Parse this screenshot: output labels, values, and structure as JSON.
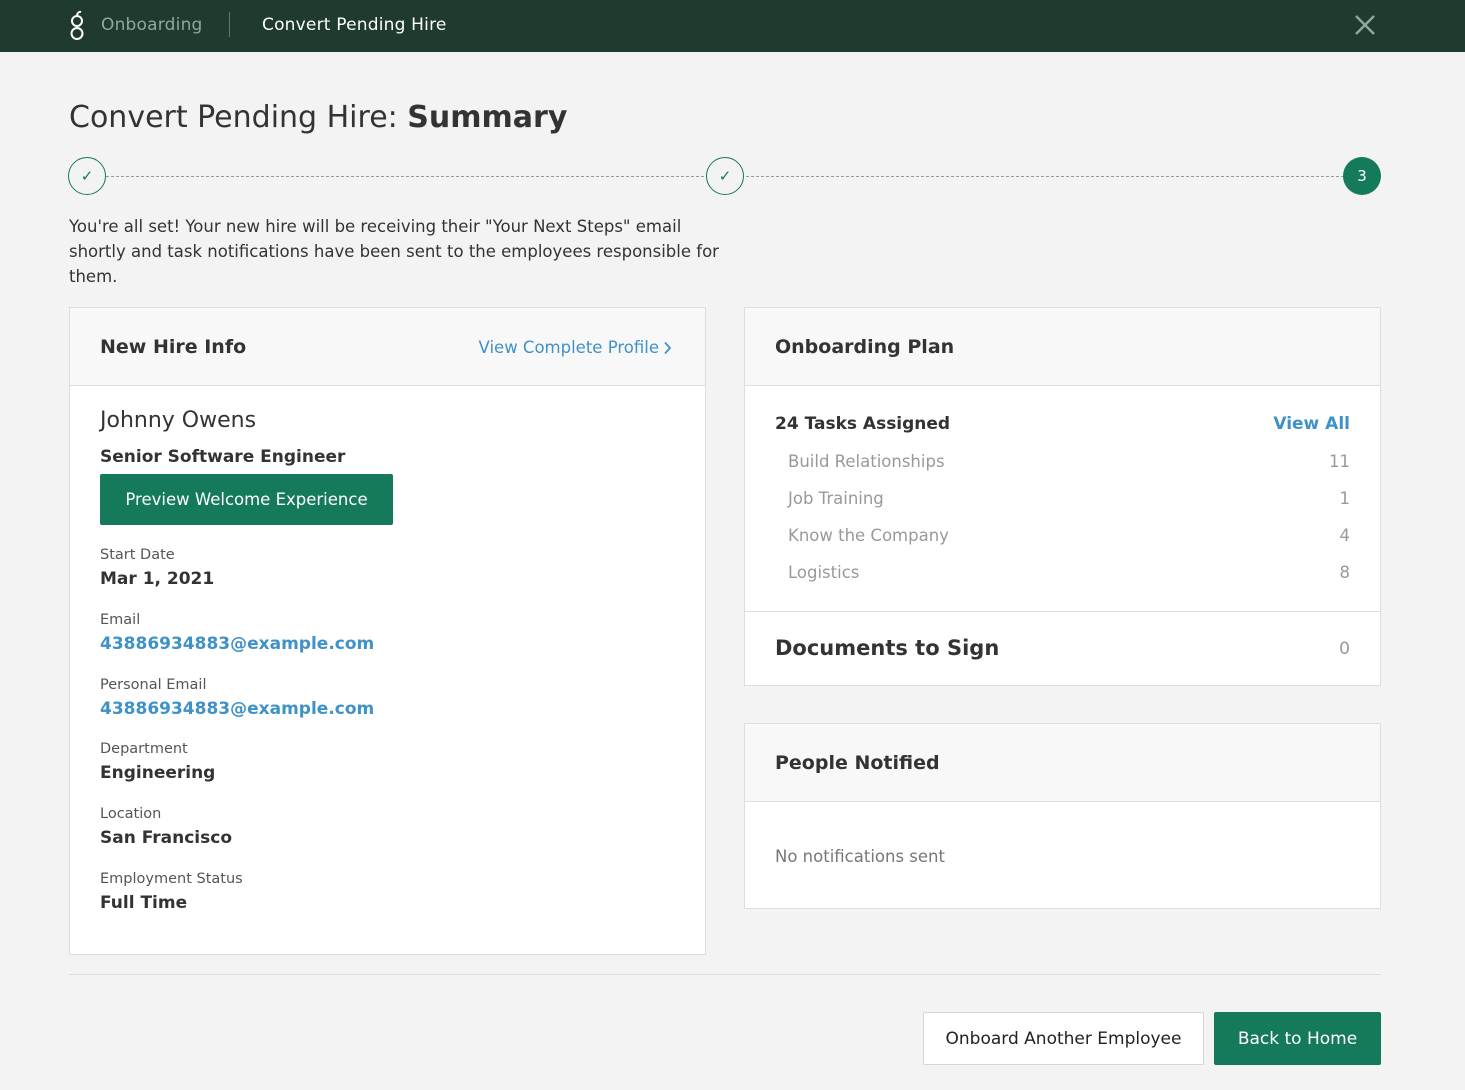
{
  "header": {
    "breadcrumb_root": "Onboarding",
    "breadcrumb_current": "Convert Pending Hire",
    "logo_icon": "greenhouse-g-logo",
    "close_icon": "close-icon"
  },
  "page": {
    "title_prefix": "Convert Pending Hire: ",
    "title_bold": "Summary",
    "intro": "You're all set! Your new hire will be receiving their \"Your Next Steps\" email shortly and task notifications have been sent to the employees responsible for them."
  },
  "stepper": {
    "steps": [
      {
        "label": "✓",
        "state": "done"
      },
      {
        "label": "✓",
        "state": "done"
      },
      {
        "label": "3",
        "state": "active"
      }
    ]
  },
  "new_hire": {
    "card_title": "New Hire Info",
    "view_profile_label": "View Complete Profile",
    "name": "Johnny Owens",
    "job_title": "Senior Software Engineer",
    "preview_button": "Preview Welcome Experience",
    "fields": [
      {
        "label": "Start Date",
        "value": "Mar 1, 2021"
      },
      {
        "label": "Email",
        "value": "43886934883@example.com"
      },
      {
        "label": "Personal Email",
        "value": "43886934883@example.com"
      },
      {
        "label": "Department",
        "value": "Engineering"
      },
      {
        "label": "Location",
        "value": "San Francisco"
      },
      {
        "label": "Employment Status",
        "value": "Full Time"
      }
    ]
  },
  "onboarding_plan": {
    "card_title": "Onboarding Plan",
    "tasks_heading": "24 Tasks Assigned",
    "view_all_label": "View All",
    "tasks": [
      {
        "name": "Build Relationships",
        "count": "11"
      },
      {
        "name": "Job Training",
        "count": "1"
      },
      {
        "name": "Know the Company",
        "count": "4"
      },
      {
        "name": "Logistics",
        "count": "8"
      }
    ],
    "documents_label": "Documents to Sign",
    "documents_count": "0"
  },
  "people_notified": {
    "card_title": "People Notified",
    "empty_text": "No notifications sent"
  },
  "footer": {
    "secondary_button": "Onboard Another Employee",
    "primary_button": "Back to Home"
  },
  "colors": {
    "topbar": "#1f3a2e",
    "brand_green": "#157a5b",
    "link_blue": "#3f92c8"
  }
}
